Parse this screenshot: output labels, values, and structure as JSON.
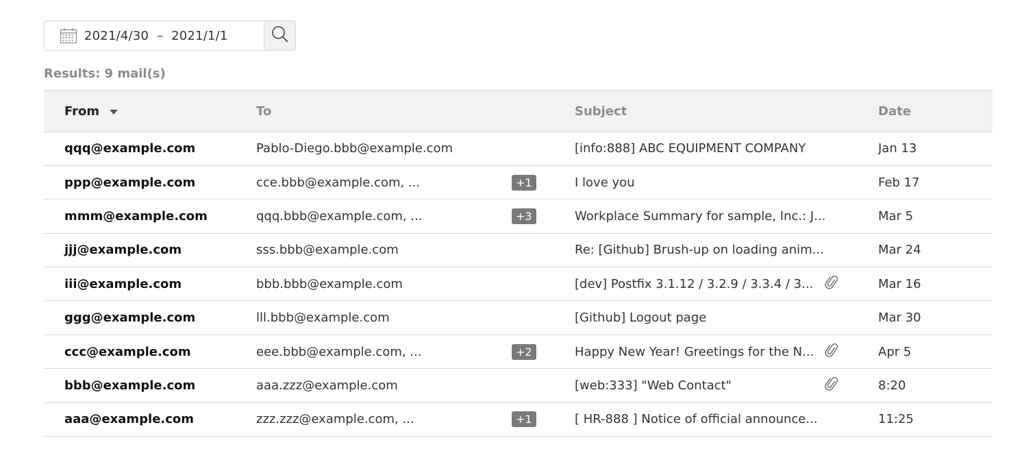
{
  "search": {
    "date_from": "2021/4/30",
    "date_separator": "–",
    "date_to": "2021/1/1",
    "calendar_icon": "calendar-icon",
    "search_icon": "search-icon"
  },
  "results_label": "Results: 9 mail(s)",
  "table": {
    "headers": {
      "from": "From",
      "to": "To",
      "subject": "Subject",
      "date": "Date"
    },
    "sort_indicator": "caret-down-icon",
    "rows": [
      {
        "from": "qqq@example.com",
        "to": "Pablo-Diego.bbb@example.com",
        "extra": "",
        "subject": "[info:888] ABC EQUIPMENT COMPANY",
        "attachment": false,
        "date": "Jan 13"
      },
      {
        "from": "ppp@example.com",
        "to": "cce.bbb@example.com, ...",
        "extra": "+1",
        "subject": "I love you",
        "attachment": false,
        "date": "Feb 17"
      },
      {
        "from": "mmm@example.com",
        "to": "qqq.bbb@example.com, ...",
        "extra": "+3",
        "subject": "Workplace Summary for sample, Inc.: J...",
        "attachment": false,
        "date": "Mar 5"
      },
      {
        "from": "jjj@example.com",
        "to": "sss.bbb@example.com",
        "extra": "",
        "subject": "Re: [Github] Brush-up on loading anim...",
        "attachment": false,
        "date": "Mar 24"
      },
      {
        "from": "iii@example.com",
        "to": "bbb.bbb@example.com",
        "extra": "",
        "subject": "[dev]   Postfix 3.1.12 / 3.2.9 / 3.3.4 / 3...",
        "attachment": true,
        "date": "Mar 16"
      },
      {
        "from": "ggg@example.com",
        "to": "lll.bbb@example.com",
        "extra": "",
        "subject": "[Github] Logout page",
        "attachment": false,
        "date": "Mar 30"
      },
      {
        "from": "ccc@example.com",
        "to": "eee.bbb@example.com, ...",
        "extra": "+2",
        "subject": "Happy New Year! Greetings for the N...",
        "attachment": true,
        "date": "Apr 5"
      },
      {
        "from": "bbb@example.com",
        "to": "aaa.zzz@example.com",
        "extra": "",
        "subject": "[web:333] \"Web Contact\"",
        "attachment": true,
        "date": "8:20"
      },
      {
        "from": "aaa@example.com",
        "to": "zzz.zzz@example.com, ...",
        "extra": "+1",
        "subject": "[ HR-888 ] Notice of official announce...",
        "attachment": false,
        "date": "11:25"
      }
    ]
  },
  "colors": {
    "header_bg": "#f2f2f2",
    "badge_bg": "#7a7a7a",
    "muted_text": "#8a8a8a",
    "border": "#dadada"
  }
}
